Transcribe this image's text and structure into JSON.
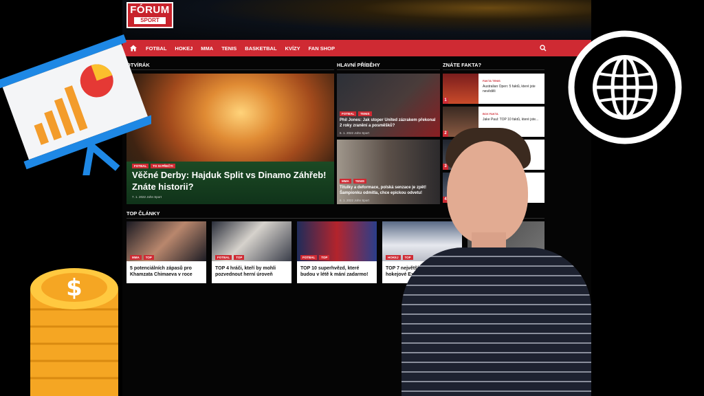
{
  "brand": {
    "name_top": "FÓRUM",
    "name_bottom": "SPORT"
  },
  "nav": {
    "items": [
      "FOTBAL",
      "HOKEJ",
      "MMA",
      "TENIS",
      "BASKETBAL",
      "KVÍZY",
      "FAN SHOP"
    ]
  },
  "sections": {
    "opener": "OTVÍRÁK",
    "main_stories": "HLAVNÍ PŘÍBĚHY",
    "facts": "ZNÁTE FAKTA?",
    "top_articles": "TOP ČLÁNKY"
  },
  "hero": {
    "tags": [
      "FOTBAL",
      "TO SI PŘEČTI"
    ],
    "title": "Věčné Derby: Hajduk Split vs Dinamo Záhřeb! Znáte historii?",
    "date": "7. 1. 2022",
    "author": "John Sport"
  },
  "main_stories": [
    {
      "tags": [
        "FOTBAL",
        "TENIS"
      ],
      "title": "Phil Jones: Jak stoper United zázrakem překonal 2 roky zranění a posměšků?",
      "date": "6. 1. 2022",
      "author": "John Sport"
    },
    {
      "tags": [
        "MMA",
        "TENIS"
      ],
      "title": "Titulky a deformace, polská senzace je zpět! Šampionku odmítla, chce epickou odvetu!",
      "date": "6. 1. 2022",
      "author": "John Sport"
    }
  ],
  "facts": [
    {
      "num": "1",
      "tag": "FAKTA TENIS",
      "text": "Australian Open: 5 faktů, které jste nevěděli"
    },
    {
      "num": "2",
      "tag": "BOX FAKTA",
      "text": "Jake Paul: TOP 10 faktů, které jste..."
    },
    {
      "num": "3",
      "tag": "",
      "text": ""
    },
    {
      "num": "4",
      "tag": "",
      "text": ""
    }
  ],
  "top_articles": [
    {
      "tags": [
        "MMA",
        "TOP"
      ],
      "title": "5 potenciálních zápasů pro Khamzata Chimaeva v roce"
    },
    {
      "tags": [
        "FOTBAL",
        "TOP"
      ],
      "title": "TOP 4 hráči, kteří by mohli pozvednout herní úroveň"
    },
    {
      "tags": [
        "FOTBAL",
        "TOP"
      ],
      "title": "TOP 10 superhvězd, které budou v létě k mání zadarmo!"
    },
    {
      "tags": [
        "HOKEJ",
        "TOP"
      ],
      "title": "TOP 7 největších rivalit v hokejové Extralize"
    }
  ],
  "colors": {
    "accent": "#cf2a33",
    "background": "#000000"
  },
  "icons": [
    "home-icon",
    "search-icon",
    "globe-icon",
    "chart-presentation-icon",
    "coins-icon"
  ]
}
